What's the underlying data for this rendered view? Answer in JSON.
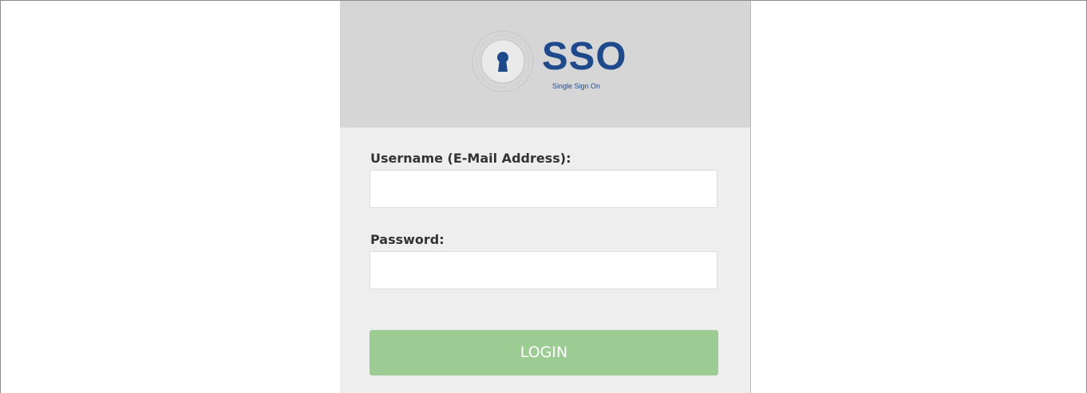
{
  "logo": {
    "title": "SSO",
    "subtitle": "Single Sign On",
    "icon": "keyhole-icon",
    "brand_color": "#1e4a8b"
  },
  "form": {
    "username_label": "Username (E-Mail Address):",
    "username_value": "",
    "username_placeholder": "",
    "password_label": "Password:",
    "password_value": "",
    "password_placeholder": "",
    "login_label": "LOGIN",
    "login_color": "#9ccc94"
  },
  "colors": {
    "header_bg": "#d6d6d6",
    "card_bg": "#eeeeee"
  }
}
